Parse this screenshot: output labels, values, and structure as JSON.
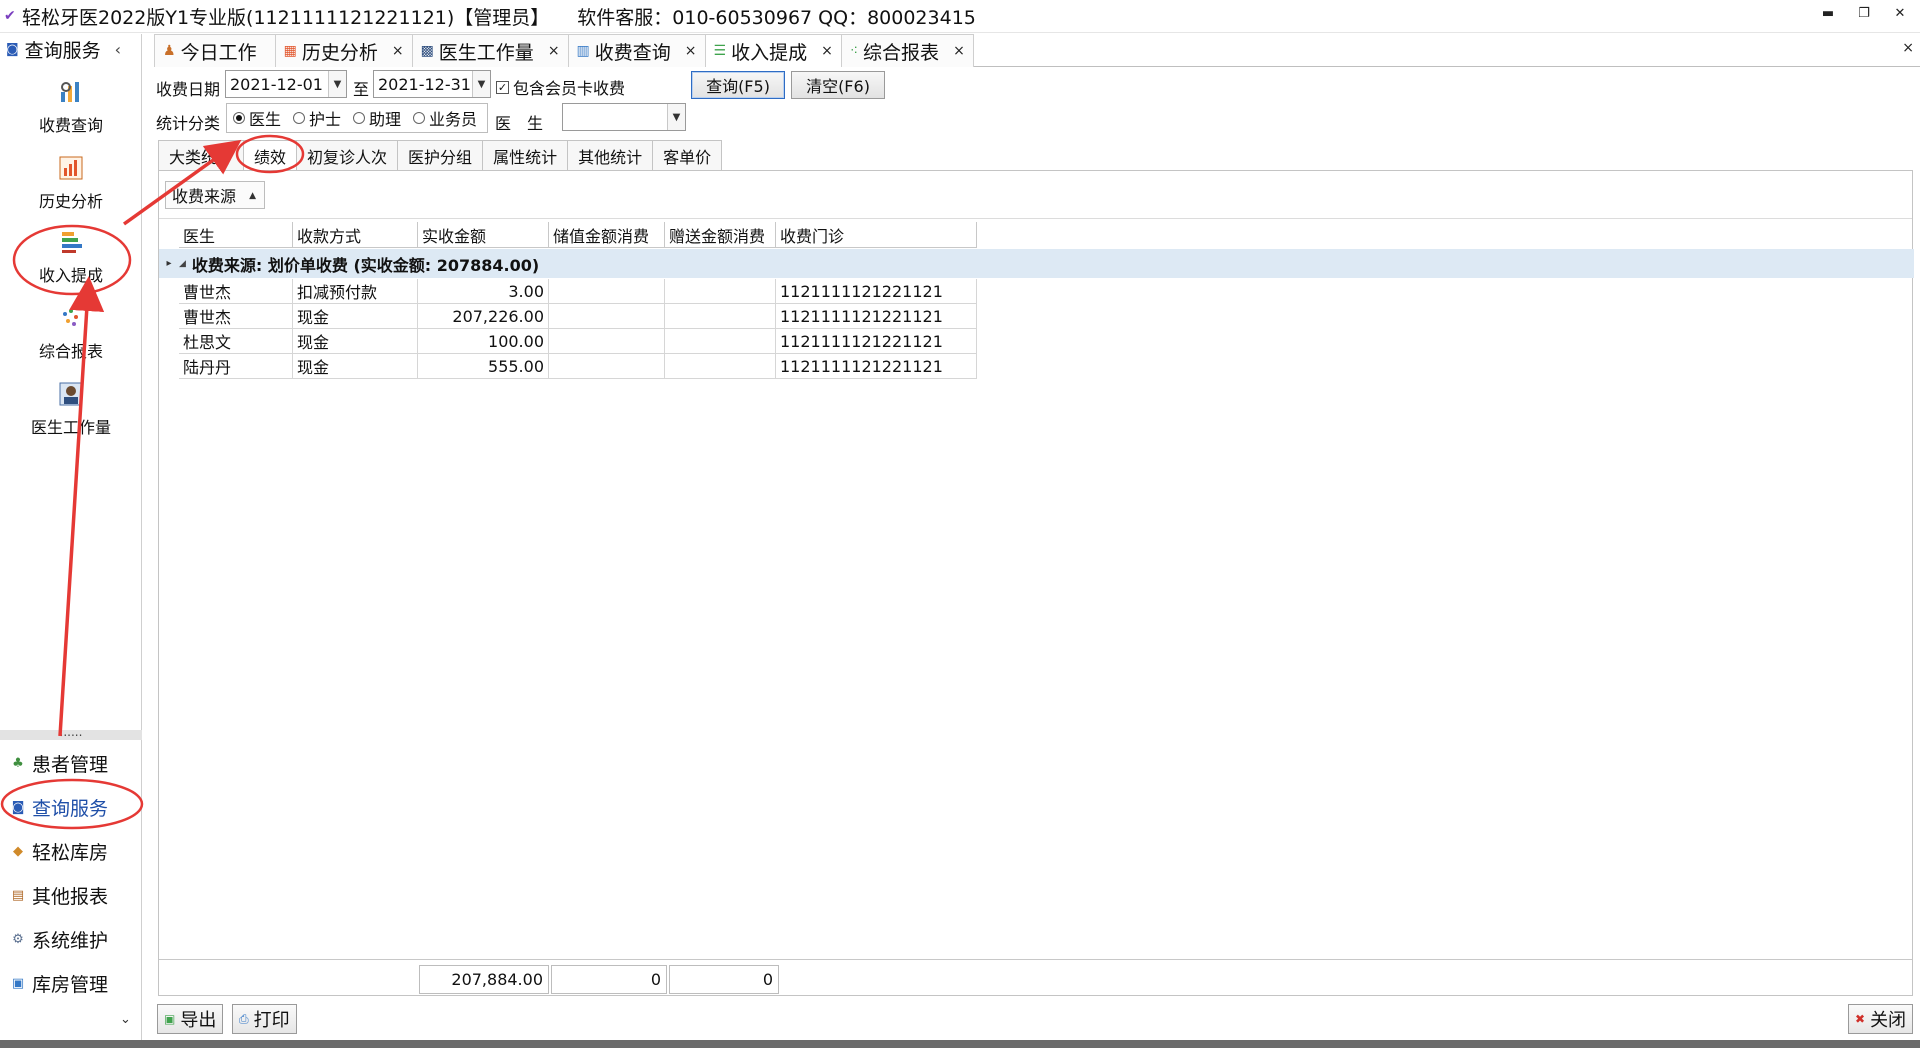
{
  "window": {
    "title": "轻松牙医2022版Y1专业版(1121111121221121)【管理员】",
    "support": "软件客服：010-60530967 QQ：800023415",
    "controls": [
      "▬",
      "❐",
      "✕"
    ]
  },
  "sidebar": {
    "header": "查询服务",
    "items": [
      {
        "label": "收费查询",
        "icon": "chart-search-icon"
      },
      {
        "label": "历史分析",
        "icon": "history-chart-icon"
      },
      {
        "label": "收入提成",
        "icon": "income-bars-icon"
      },
      {
        "label": "综合报表",
        "icon": "report-dots-icon"
      },
      {
        "label": "医生工作量",
        "icon": "doctor-icon"
      }
    ],
    "splitter": "......",
    "nav": [
      {
        "label": "患者管理",
        "icon": "patients-icon"
      },
      {
        "label": "查询服务",
        "icon": "query-icon",
        "active": true
      },
      {
        "label": "轻松库房",
        "icon": "warehouse-icon"
      },
      {
        "label": "其他报表",
        "icon": "reports-icon"
      },
      {
        "label": "系统维护",
        "icon": "maintenance-icon"
      },
      {
        "label": "库房管理",
        "icon": "storage-icon"
      }
    ]
  },
  "doc_tabs": [
    {
      "label": "今日工作",
      "closable": false
    },
    {
      "label": "历史分析",
      "closable": true
    },
    {
      "label": "医生工作量",
      "closable": true
    },
    {
      "label": "收费查询",
      "closable": true
    },
    {
      "label": "收入提成",
      "closable": true,
      "active": true
    },
    {
      "label": "综合报表",
      "closable": true
    }
  ],
  "filters": {
    "date_label": "收费日期",
    "date_from": "2021-12-01",
    "to_label": "至",
    "date_to": "2021-12-31",
    "include_member_card": "包含会员卡收费",
    "query_button": "查询(F5)",
    "clear_button": "清空(F6)",
    "category_label": "统计分类",
    "categories": [
      "医生",
      "护士",
      "助理",
      "业务员"
    ],
    "selected_category": "医生",
    "doctor_label": "医　生",
    "doctor_value": ""
  },
  "sub_tabs": [
    "大类统计",
    "绩效",
    "初复诊人次",
    "医护分组",
    "属性统计",
    "其他统计",
    "客单价"
  ],
  "active_sub_tab": "绩效",
  "grid": {
    "group_by": "收费来源",
    "columns": [
      "医生",
      "收款方式",
      "实收金额",
      "储值金额消费",
      "赠送金额消费",
      "收费门诊"
    ],
    "group_row": "收费来源: 划价单收费 (实收金额: 207884.00)",
    "rows": [
      [
        "曹世杰",
        "扣减预付款",
        "3.00",
        "",
        "",
        "1121111121221121"
      ],
      [
        "曹世杰",
        "现金",
        "207,226.00",
        "",
        "",
        "1121111121221121"
      ],
      [
        "杜思文",
        "现金",
        "100.00",
        "",
        "",
        "1121111121221121"
      ],
      [
        "陆丹丹",
        "现金",
        "555.00",
        "",
        "",
        "1121111121221121"
      ]
    ],
    "totals": {
      "actual": "207,884.00",
      "stored": "0",
      "gift": "0"
    }
  },
  "bottom": {
    "export": "导出",
    "print": "打印",
    "close": "关闭"
  },
  "annotation_color": "#e53935"
}
